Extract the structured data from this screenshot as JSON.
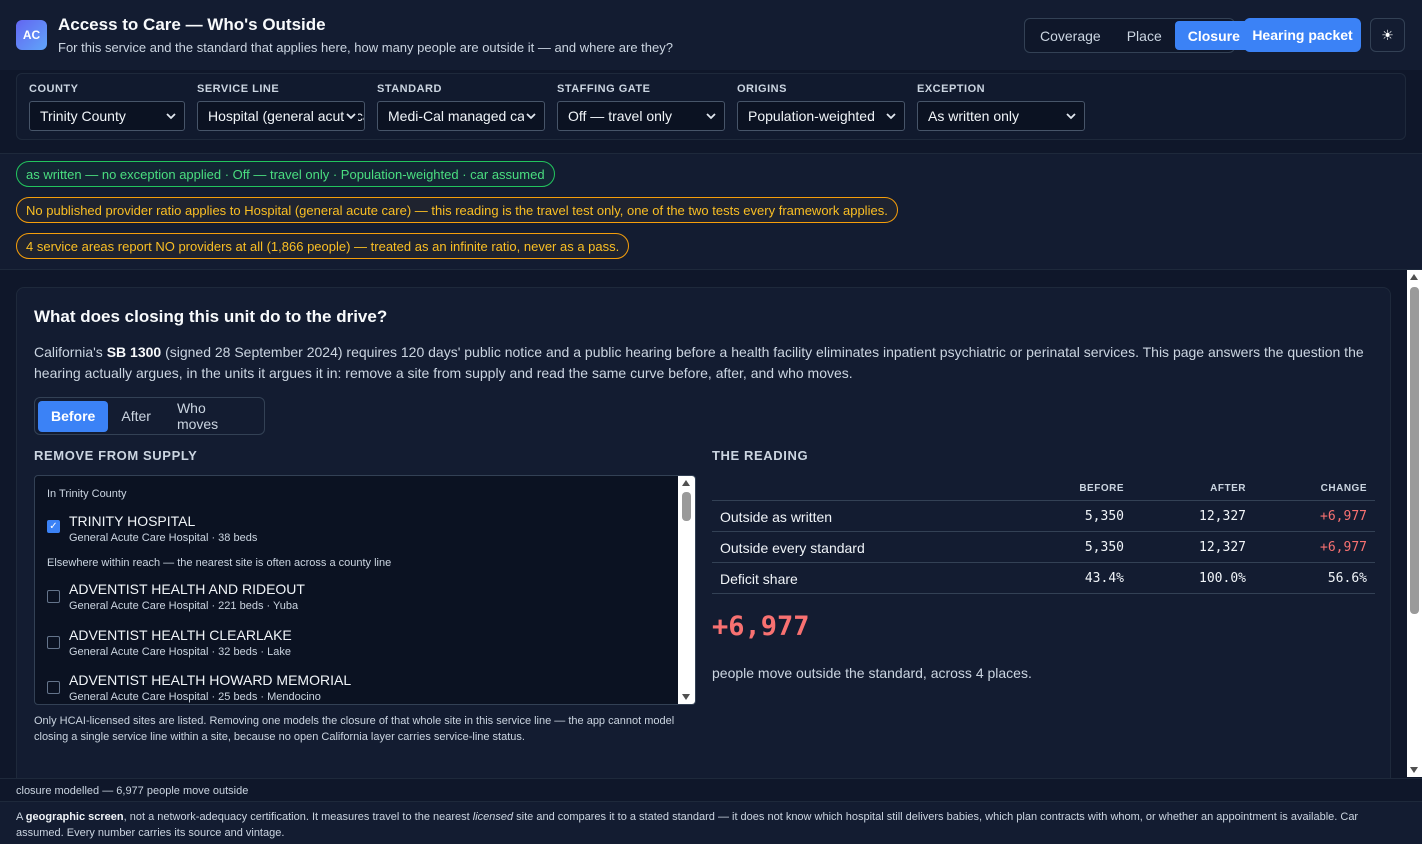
{
  "header": {
    "logo": "AC",
    "title": "Access to Care — Who's Outside",
    "subtitle": "For this service and the standard that applies here, how many people are outside it — and where are they?",
    "modes": [
      "Coverage",
      "Place",
      "Closure"
    ],
    "active_mode": "Closure",
    "packet_button": "Hearing packet",
    "theme_icon": "☀"
  },
  "filters": {
    "county": {
      "label": "County",
      "value": "Trinity County"
    },
    "service_line": {
      "label": "Service line",
      "value": "Hospital (general acute care)"
    },
    "standard": {
      "label": "Standard",
      "value": "Medi-Cal managed care"
    },
    "staffing_gate": {
      "label": "Staffing gate",
      "value": "Off — travel only"
    },
    "origins": {
      "label": "Origins",
      "value": "Population-weighted"
    },
    "exception": {
      "label": "Exception",
      "value": "As written only"
    }
  },
  "banners": {
    "status": "as written — no exception applied · Off — travel only · Population-weighted · car assumed",
    "warning_ratio": "No published provider ratio applies to Hospital (general acute care) — this reading is the travel test only, one of the two tests every framework applies.",
    "warning_zero": "4 service areas report NO providers at all (1,866 people) — treated as an infinite ratio, never as a pass."
  },
  "closure": {
    "title": "What does closing this unit do to the drive?",
    "intro_pre": "California's ",
    "intro_bill": "SB 1300",
    "intro_post": " (signed 28 September 2024) requires 120 days' public notice and a public hearing before a health facility eliminates inpatient psychiatric or perinatal services. This page answers the question the hearing actually argues, in the units it argues it in: remove a site from supply and read the same curve before, after, and who moves.",
    "view_tabs": [
      "Before",
      "After",
      "Who moves"
    ],
    "active_view": "Before",
    "remove_heading": "Remove from supply",
    "group_in_county": "In Trinity County",
    "group_elsewhere": "Elsewhere within reach — the nearest site is often across a county line",
    "sites": [
      {
        "name": "TRINITY HOSPITAL",
        "meta": "General Acute Care Hospital · 38 beds",
        "checked": true
      },
      {
        "name": "ADVENTIST HEALTH AND RIDEOUT",
        "meta": "General Acute Care Hospital · 221 beds · Yuba",
        "checked": false
      },
      {
        "name": "ADVENTIST HEALTH CLEARLAKE",
        "meta": "General Acute Care Hospital · 32 beds · Lake",
        "checked": false
      },
      {
        "name": "ADVENTIST HEALTH HOWARD MEMORIAL",
        "meta": "General Acute Care Hospital · 25 beds · Mendocino",
        "checked": false
      }
    ],
    "list_note": "Only HCAI-licensed sites are listed. Removing one models the closure of that whole site in this service line — the app cannot model closing a single service line within a site, because no open California layer carries service-line status.",
    "reading_heading": "The reading",
    "columns": [
      "Before",
      "After",
      "Change"
    ],
    "rows": [
      {
        "label": "Outside as written",
        "before": "5,350",
        "after": "12,327",
        "change": "+6,977"
      },
      {
        "label": "Outside every standard",
        "before": "5,350",
        "after": "12,327",
        "change": "+6,977"
      },
      {
        "label": "Deficit share",
        "before": "43.4%",
        "after": "100.0%",
        "change": "56.6%"
      }
    ],
    "delta": "+6,977",
    "delta_caption": "people move outside the standard, across 4 places."
  },
  "status_bar": "closure modelled — 6,977 people move outside",
  "footer": {
    "pre": "A ",
    "bold": "geographic screen",
    "mid": ", not a network-adequacy certification. It measures travel to the nearest ",
    "italic": "licensed",
    "post": " site and compares it to a stated standard — it does not know which hospital still delivers babies, which plan contracts with whom, or whether an appointment is available. Car assumed. Every number carries its source and vintage."
  },
  "colors": {
    "accent": "#3b82f6",
    "negative": "#f87171",
    "ok": "#22c55e",
    "warn": "#f59e0b"
  }
}
